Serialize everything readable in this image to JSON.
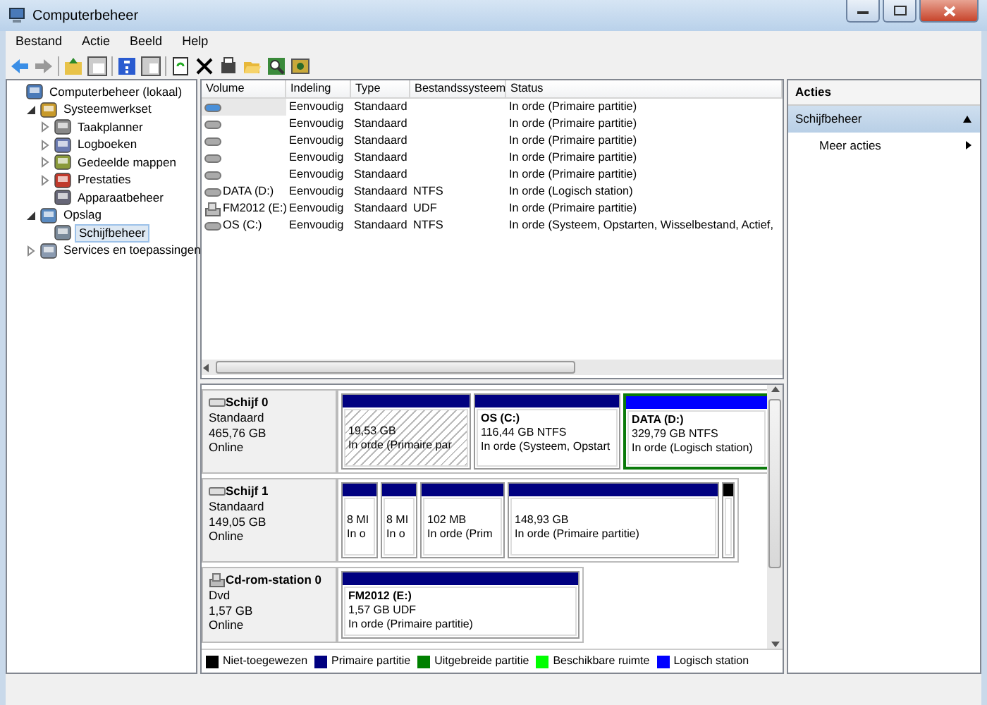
{
  "window": {
    "title": "Computerbeheer"
  },
  "menu": [
    "Bestand",
    "Actie",
    "Beeld",
    "Help"
  ],
  "tree": [
    {
      "label": "Computerbeheer (lokaal)",
      "selected": false,
      "children": [
        {
          "label": "Systeemwerkset",
          "expanded": true,
          "selected": false,
          "children": [
            {
              "label": "Taakplanner",
              "expanded": false,
              "selected": false
            },
            {
              "label": "Logboeken",
              "expanded": false,
              "selected": false
            },
            {
              "label": "Gedeelde mappen",
              "expanded": false,
              "selected": false
            },
            {
              "label": "Prestaties",
              "expanded": false,
              "selected": false
            },
            {
              "label": "Apparaatbeheer",
              "selected": false
            }
          ]
        },
        {
          "label": "Opslag",
          "expanded": true,
          "selected": false,
          "children": [
            {
              "label": "Schijfbeheer",
              "selected": true
            }
          ]
        },
        {
          "label": "Services en toepassingen",
          "expanded": false,
          "selected": false
        }
      ]
    }
  ],
  "volumes": {
    "columns": [
      "Volume",
      "Indeling",
      "Type",
      "Bestandssysteem",
      "Status"
    ],
    "rows": [
      {
        "kind": "disk",
        "selected": true,
        "layout": "Eenvoudig",
        "type": "Standaard",
        "status": "In orde (Primaire partitie)"
      },
      {
        "kind": "disk",
        "selected": false,
        "layout": "Eenvoudig",
        "type": "Standaard",
        "status": "In orde (Primaire partitie)"
      },
      {
        "kind": "disk",
        "selected": false,
        "layout": "Eenvoudig",
        "type": "Standaard",
        "status": "In orde (Primaire partitie)"
      },
      {
        "kind": "disk",
        "selected": false,
        "layout": "Eenvoudig",
        "type": "Standaard",
        "status": "In orde (Primaire partitie)"
      },
      {
        "kind": "disk",
        "selected": false,
        "layout": "Eenvoudig",
        "type": "Standaard",
        "status": "In orde (Primaire partitie)"
      },
      {
        "kind": "disk",
        "selected": false,
        "volume": "DATA (D:)",
        "layout": "Eenvoudig",
        "type": "Standaard",
        "filesystem": "NTFS",
        "status": "In orde (Logisch station)"
      },
      {
        "kind": "cd",
        "selected": false,
        "volume": "FM2012 (E:)",
        "layout": "Eenvoudig",
        "type": "Standaard",
        "filesystem": "UDF",
        "status": "In orde (Primaire partitie)"
      },
      {
        "kind": "disk",
        "selected": false,
        "volume": "OS (C:)",
        "layout": "Eenvoudig",
        "type": "Standaard",
        "filesystem": "NTFS",
        "status": "In orde (Systeem, Opstarten, Wisselbestand, Actief,"
      }
    ]
  },
  "disks": [
    {
      "kind": "disk",
      "name": "Schijf 0",
      "type": "Standaard",
      "size": "465,76 GB",
      "status": "Online",
      "partitions": [
        {
          "kind": "primary",
          "selected": false,
          "hatched": true,
          "lines": [
            "19,53 GB",
            "In orde (Primaire par"
          ]
        },
        {
          "kind": "primary",
          "selected": false,
          "hatched": false,
          "name": "OS  (C:)",
          "lines": [
            "116,44 GB NTFS",
            "In orde (Systeem, Opstart"
          ]
        },
        {
          "kind": "logical",
          "selected": true,
          "hatched": false,
          "name": "DATA  (D:)",
          "lines": [
            "329,79 GB NTFS",
            "In orde (Logisch station)"
          ]
        }
      ]
    },
    {
      "kind": "disk",
      "name": "Schijf 1",
      "type": "Standaard",
      "size": "149,05 GB",
      "status": "Online",
      "partitions": [
        {
          "kind": "primary",
          "selected": false,
          "hatched": false,
          "lines": [
            "8 MI",
            "In o"
          ]
        },
        {
          "kind": "primary",
          "selected": false,
          "hatched": false,
          "lines": [
            "8 MI",
            "In o"
          ]
        },
        {
          "kind": "primary",
          "selected": false,
          "hatched": false,
          "lines": [
            "102 MB",
            "In orde (Prim"
          ]
        },
        {
          "kind": "primary",
          "selected": false,
          "hatched": false,
          "lines": [
            "148,93 GB",
            "In orde (Primaire partitie)"
          ]
        },
        {
          "kind": "unallocated",
          "selected": false,
          "hatched": false
        }
      ]
    },
    {
      "kind": "cd",
      "name": "Cd-rom-station 0",
      "type": "Dvd",
      "size": "1,57 GB",
      "status": "Online",
      "partitions": [
        {
          "kind": "primary",
          "selected": false,
          "hatched": false,
          "name": "FM2012  (E:)",
          "lines": [
            "1,57 GB UDF",
            "In orde (Primaire partitie)"
          ]
        }
      ]
    }
  ],
  "legend": [
    {
      "label": "Niet-toegewezen",
      "color": "#000000"
    },
    {
      "label": "Primaire partitie",
      "color": "#000080"
    },
    {
      "label": "Uitgebreide partitie",
      "color": "#008000"
    },
    {
      "label": "Beschikbare ruimte",
      "color": "#00ff00"
    },
    {
      "label": "Logisch station",
      "color": "#0000ff"
    }
  ],
  "actions": {
    "title": "Acties",
    "sections": [
      {
        "label": "Schijfbeheer",
        "expanded": true,
        "items": [
          "Meer acties"
        ]
      }
    ]
  }
}
